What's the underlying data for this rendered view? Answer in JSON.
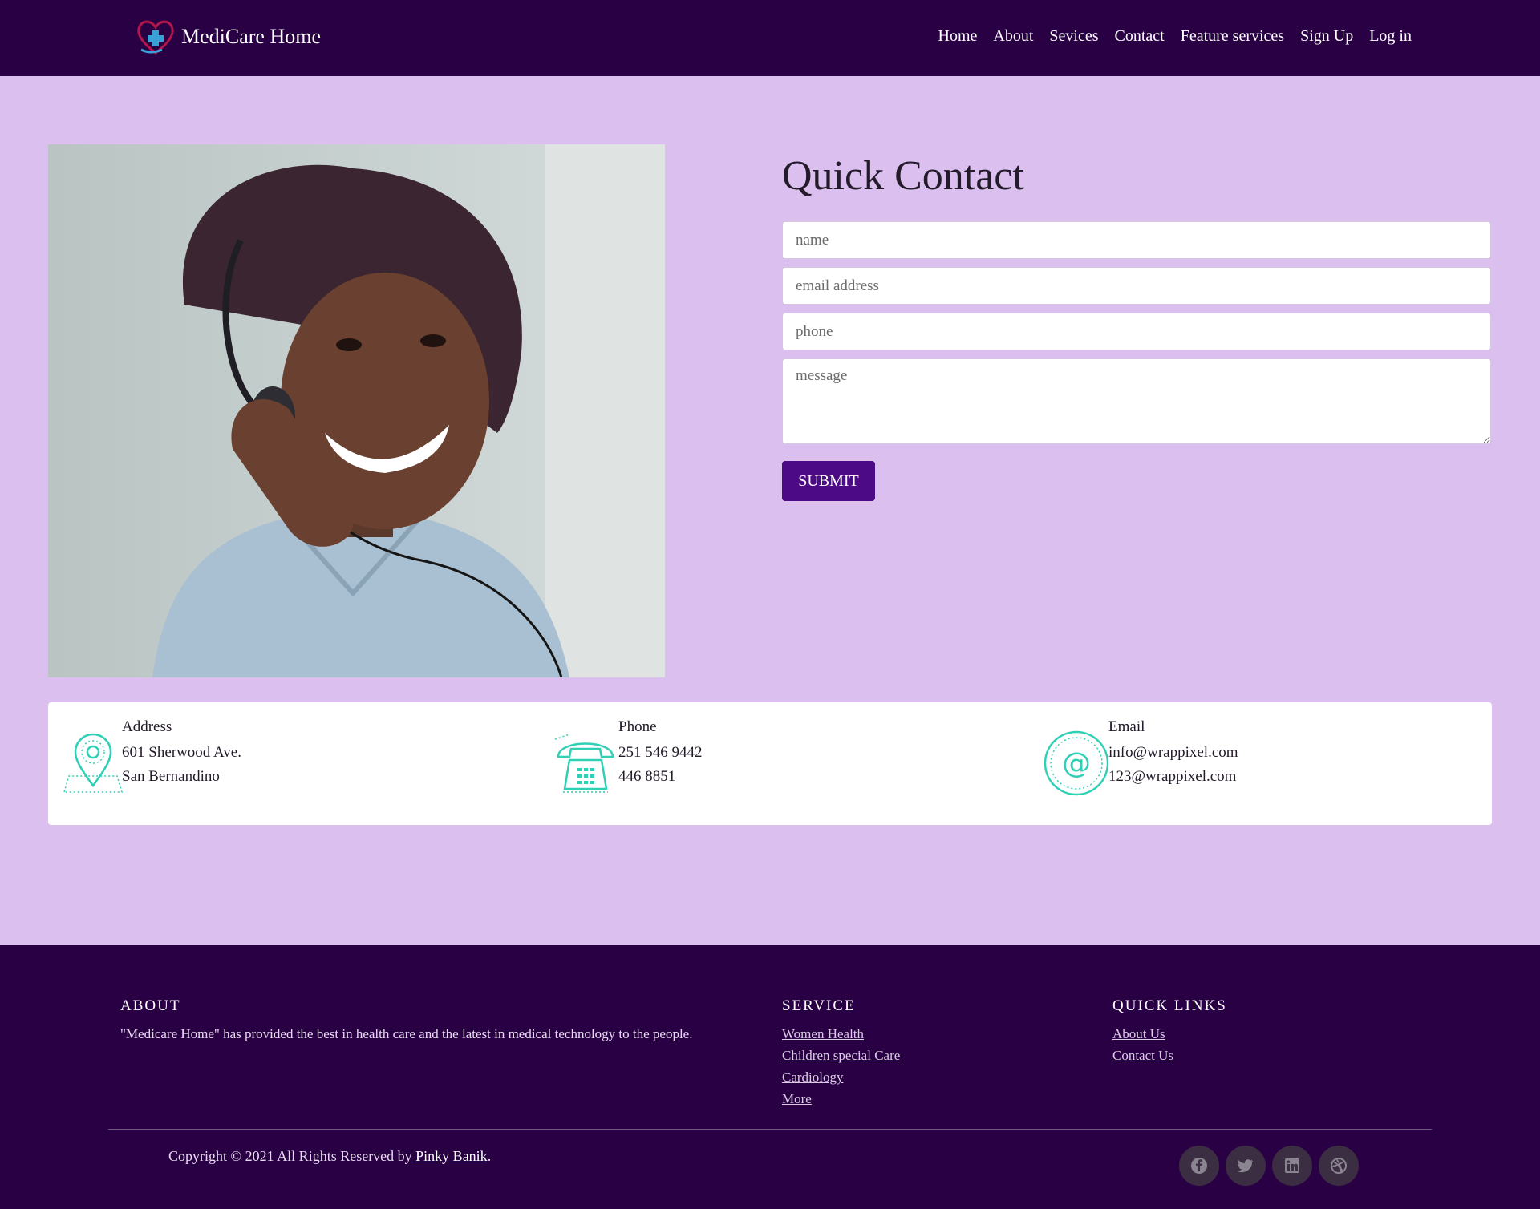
{
  "nav": {
    "brand": "MediCare Home",
    "links": [
      "Home",
      "About",
      "Sevices",
      "Contact",
      "Feature services",
      "Sign Up",
      "Log in"
    ]
  },
  "contact": {
    "title": "Quick Contact",
    "name_placeholder": "name",
    "email_placeholder": "email address",
    "phone_placeholder": "phone",
    "message_placeholder": "message",
    "submit_label": "SUBMIT"
  },
  "info": {
    "address": {
      "title": "Address",
      "line1": "601 Sherwood Ave.",
      "line2": "San Bernandino",
      "icon": "map-pin-icon"
    },
    "phone": {
      "title": "Phone",
      "line1": "251 546 9442",
      "line2": "446 8851",
      "icon": "telephone-icon"
    },
    "email": {
      "title": "Email",
      "line1": "info@wrappixel.com",
      "line2": "123@wrappixel.com",
      "icon": "at-sign-icon"
    },
    "accent_color": "#2fd0b5"
  },
  "footer": {
    "about": {
      "heading": "ABOUT",
      "text": "\"Medicare Home\" has provided the best in health care and the latest in medical technology to the people."
    },
    "service": {
      "heading": "SERVICE",
      "links": [
        "Women Health",
        "Children special Care",
        "Cardiology",
        "More"
      ]
    },
    "quick_links": {
      "heading": "QUICK LINKS",
      "links": [
        "About Us",
        "Contact Us"
      ]
    },
    "copyright_prefix": "Copyright © 2021 All Rights Reserved by",
    "copyright_author": " Pinky Banik",
    "copyright_suffix": ".",
    "socials": [
      "facebook-icon",
      "twitter-icon",
      "linkedin-icon",
      "dribbble-icon"
    ]
  },
  "colors": {
    "nav_bg": "#2a0045",
    "page_bg": "#dbbfee",
    "button_bg": "#4d0a86"
  }
}
